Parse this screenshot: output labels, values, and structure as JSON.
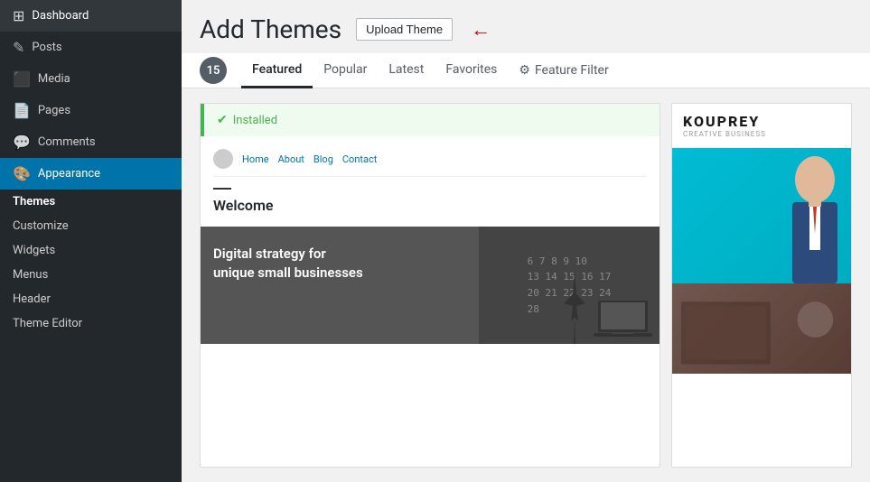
{
  "sidebar": {
    "items": [
      {
        "id": "dashboard",
        "label": "Dashboard",
        "icon": "⊞",
        "active": false
      },
      {
        "id": "posts",
        "label": "Posts",
        "icon": "✎",
        "active": false
      },
      {
        "id": "media",
        "label": "Media",
        "icon": "⬛",
        "active": false
      },
      {
        "id": "pages",
        "label": "Pages",
        "icon": "📄",
        "active": false
      },
      {
        "id": "comments",
        "label": "Comments",
        "icon": "💬",
        "active": false
      },
      {
        "id": "appearance",
        "label": "Appearance",
        "icon": "🎨",
        "active": true
      }
    ],
    "submenu": [
      {
        "id": "themes",
        "label": "Themes",
        "active": true
      },
      {
        "id": "customize",
        "label": "Customize",
        "active": false
      },
      {
        "id": "widgets",
        "label": "Widgets",
        "active": false
      },
      {
        "id": "menus",
        "label": "Menus",
        "active": false
      },
      {
        "id": "header",
        "label": "Header",
        "active": false
      },
      {
        "id": "theme-editor",
        "label": "Theme Editor",
        "active": false
      }
    ]
  },
  "header": {
    "title": "Add Themes",
    "upload_button": "Upload Theme"
  },
  "tabs": {
    "count": "15",
    "items": [
      {
        "id": "featured",
        "label": "Featured",
        "active": true
      },
      {
        "id": "popular",
        "label": "Popular",
        "active": false
      },
      {
        "id": "latest",
        "label": "Latest",
        "active": false
      },
      {
        "id": "favorites",
        "label": "Favorites",
        "active": false
      },
      {
        "id": "feature-filter",
        "label": "Feature Filter",
        "active": false
      }
    ]
  },
  "themes": {
    "installed_label": "Installed",
    "theme1": {
      "nav_links": [
        "Home",
        "About",
        "Blog",
        "Contact"
      ],
      "welcome_text": "Welcome",
      "dark_text": "Digital strategy for\nunique small businesses",
      "calendar_lines": [
        "6  7  8  9 10",
        "13 14 15 16 17",
        "20 21 22 23 24",
        "   28"
      ]
    },
    "theme2": {
      "name": "KOUPREY",
      "sub": "CREATIVE BUSINESS"
    }
  }
}
